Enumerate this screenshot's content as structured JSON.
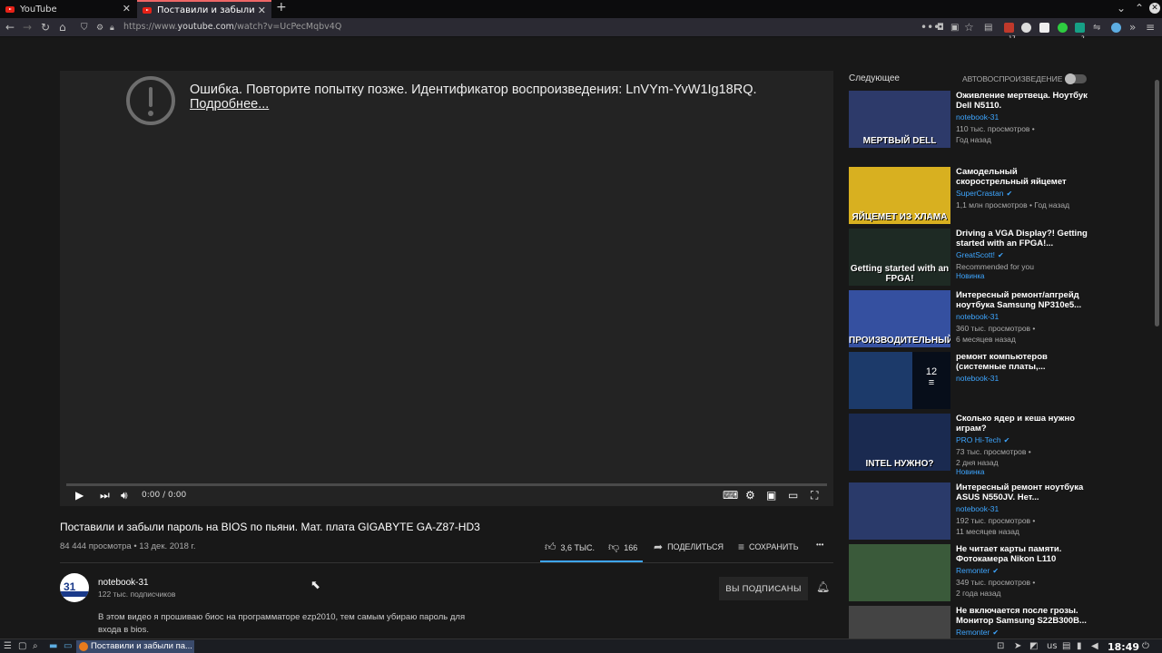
{
  "browser": {
    "tabs": [
      {
        "label": "YouTube"
      },
      {
        "label": "Поставили и забыли пар"
      }
    ],
    "new_tab": "+",
    "url_prefix": "https://www.",
    "url_domain": "youtube.com",
    "url_rest": "/watch?v=UcPecMqbv4Q",
    "ext_badge_1": "17",
    "ext_badge_2": "2"
  },
  "player": {
    "error_text": "Ошибка. Повторите попытку позже. Идентификатор воспроизведения: LnVYm-YvW1Ig18RQ.",
    "error_link": "Подробнее...",
    "time": "0:00 / 0:00"
  },
  "video": {
    "title": "Поставили и забыли пароль на BIOS по пьяни. Мат. плата GIGABYTE GA-Z87-HD3",
    "views_date": "84 444 просмотра • 13 дек. 2018 г.",
    "likes": "3,6 ТЫС.",
    "dislikes": "166",
    "share": "ПОДЕЛИТЬСЯ",
    "save": "СОХРАНИТЬ",
    "more": "•••"
  },
  "channel": {
    "avatar_text": "31",
    "name": "notebook-31",
    "subs": "122 тыс. подписчиков",
    "subscribe_label": "ВЫ ПОДПИСАНЫ",
    "description": "В этом видео я прошиваю биос на программаторе ezp2010, тем самым убираю пароль для входа в bios."
  },
  "sidebar": {
    "up_next": "Следующее",
    "autoplay": "АВТОВОСПРОИЗВЕДЕНИЕ",
    "items": [
      {
        "title": "Оживление мертвеца. Ноутбук Dell N5110.",
        "channel": "notebook-31",
        "meta1": "110 тыс. просмотров •",
        "meta2": "Год назад",
        "badge": "",
        "thumb_caption": "МЕРТВЫЙ DELL",
        "thumb_color": "#2d3a6a"
      },
      {
        "title": "Самодельный скорострельный яйцемет",
        "channel": "SuperCrastan",
        "meta1": "1,1 млн просмотров • Год назад",
        "meta2": "",
        "badge": "",
        "thumb_caption": "ЯЙЦЕМЕТ ИЗ ХЛАМА",
        "thumb_color": "#d8b020"
      },
      {
        "title": "Driving a VGA Display?! Getting started with an FPGA!...",
        "channel": "GreatScott!",
        "meta1": "Recommended for you",
        "meta2": "",
        "badge": "Новинка",
        "thumb_caption": "Getting started with an FPGA!",
        "thumb_color": "#1e2a24"
      },
      {
        "title": "Интересный ремонт/апгрейд ноутбука Samsung NP310e5...",
        "channel": "notebook-31",
        "meta1": "360 тыс. просмотров •",
        "meta2": "6 месяцев назад",
        "badge": "",
        "thumb_caption": "ПРОИЗВОДИТЕЛЬНЫЙ",
        "thumb_color": "#3550a0"
      },
      {
        "title": "ремонт компьютеров (системные платы,...",
        "channel": "notebook-31",
        "meta1": "",
        "meta2": "",
        "badge": "",
        "thumb_caption": "",
        "thumb_color": "#1c3a6a",
        "playlist_count": "12"
      },
      {
        "title": "Сколько ядер и кеша нужно играм?",
        "channel": "PRO Hi-Tech",
        "meta1": "73 тыс. просмотров •",
        "meta2": "2 дня назад",
        "badge": "Новинка",
        "thumb_caption": "INTEL НУЖНО?",
        "thumb_color": "#1a2a50"
      },
      {
        "title": "Интересный ремонт ноутбука ASUS N550JV. Нет...",
        "channel": "notebook-31",
        "meta1": "192 тыс. просмотров •",
        "meta2": "11 месяцев назад",
        "badge": "",
        "thumb_caption": "",
        "thumb_color": "#2a3a6a"
      },
      {
        "title": "Не читает карты памяти. Фотокамера Nikon L110",
        "channel": "Remonter",
        "meta1": "349 тыс. просмотров •",
        "meta2": "2 года назад",
        "badge": "",
        "thumb_caption": "",
        "thumb_color": "#3a5a3a"
      },
      {
        "title": "Не включается после грозы. Монитор Samsung S22B300B...",
        "channel": "Remonter",
        "meta1": "",
        "meta2": "",
        "badge": "",
        "thumb_caption": "",
        "thumb_color": "#444"
      }
    ]
  },
  "taskbar": {
    "task_label": "Поставили и забыли па...",
    "lang": "us",
    "clock": "18:49"
  },
  "colors": {
    "accent": "#3ea6ff",
    "youtube_red": "#e62117",
    "background": "#181818"
  }
}
